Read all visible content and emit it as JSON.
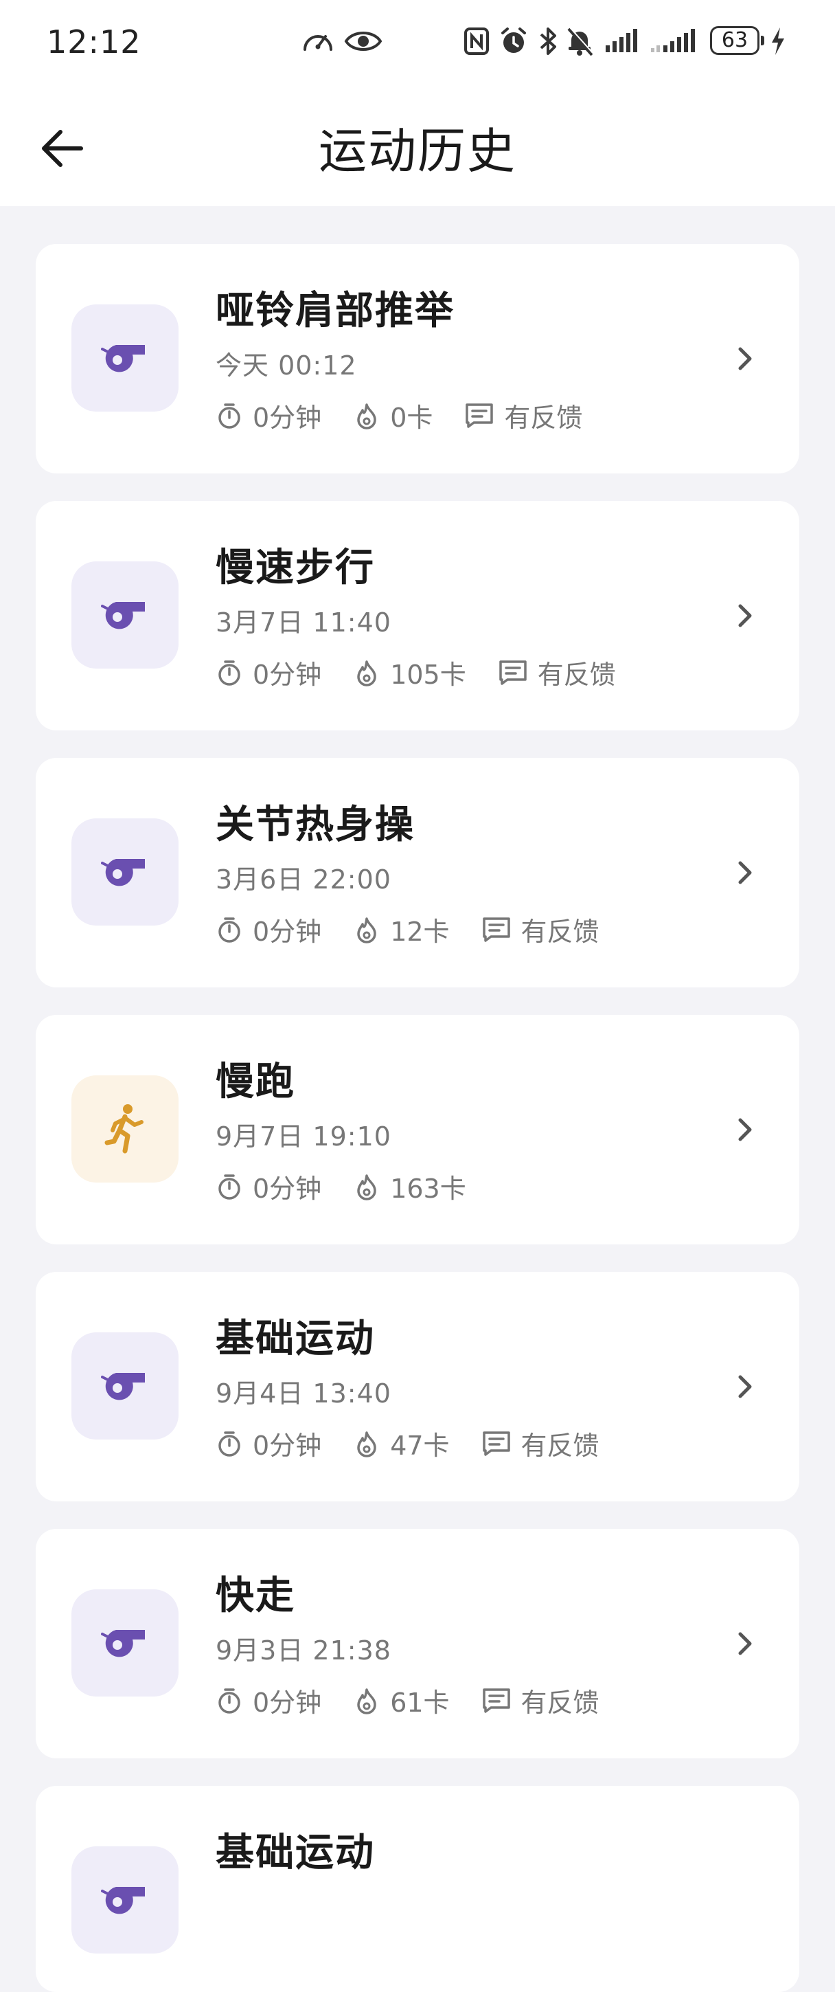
{
  "status_bar": {
    "time": "12:12",
    "battery": "63"
  },
  "header": {
    "title": "运动历史"
  },
  "records": [
    {
      "title": "哑铃肩部推举",
      "date": "今天 00:12",
      "duration": "0分钟",
      "calories": "0卡",
      "feedback": "有反馈",
      "icon": "whistle-icon"
    },
    {
      "title": "慢速步行",
      "date": "3月7日 11:40",
      "duration": "0分钟",
      "calories": "105卡",
      "feedback": "有反馈",
      "icon": "whistle-icon"
    },
    {
      "title": "关节热身操",
      "date": "3月6日 22:00",
      "duration": "0分钟",
      "calories": "12卡",
      "feedback": "有反馈",
      "icon": "whistle-icon"
    },
    {
      "title": "慢跑",
      "date": "9月7日 19:10",
      "duration": "0分钟",
      "calories": "163卡",
      "icon": "running-icon"
    },
    {
      "title": "基础运动",
      "date": "9月4日 13:40",
      "duration": "0分钟",
      "calories": "47卡",
      "feedback": "有反馈",
      "icon": "whistle-icon"
    },
    {
      "title": "快走",
      "date": "9月3日 21:38",
      "duration": "0分钟",
      "calories": "61卡",
      "feedback": "有反馈",
      "icon": "whistle-icon"
    },
    {
      "title": "基础运动",
      "icon": "whistle-icon"
    }
  ],
  "colors": {
    "whistle": "#6a4fb0",
    "runner": "#d99a2b",
    "thumb_bg": "#efedf9",
    "run_thumb_bg": "#fcf3e5",
    "page_bg": "#f3f3f7"
  }
}
